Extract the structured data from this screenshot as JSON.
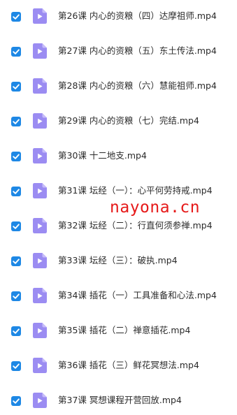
{
  "colors": {
    "checkbox": "#1e88e5",
    "file_icon": "#9b8cf2",
    "file_icon_fold": "#c7bdf9",
    "watermark": "#e61919"
  },
  "files": [
    {
      "name": "第26课 内心的资粮（四）达摩祖师.mp4",
      "checked": true,
      "icon": "video-file-icon"
    },
    {
      "name": "第27课 内心的资粮（五）东土传法.mp4",
      "checked": true,
      "icon": "video-file-icon"
    },
    {
      "name": "第28课 内心的资粮（六）慧能祖师.mp4",
      "checked": true,
      "icon": "video-file-icon"
    },
    {
      "name": "第29课 内心的资粮（七）完结.mp4",
      "checked": true,
      "icon": "video-file-icon"
    },
    {
      "name": "第30课 十二地支.mp4",
      "checked": true,
      "icon": "video-file-icon"
    },
    {
      "name": "第31课 坛经（一）：心平何劳持戒.mp4",
      "checked": true,
      "icon": "video-file-icon"
    },
    {
      "name": "第32课 坛经（二）：行直何须参禅.mp4",
      "checked": true,
      "icon": "video-file-icon"
    },
    {
      "name": "第33课 坛经（三）：破执.mp4",
      "checked": true,
      "icon": "video-file-icon"
    },
    {
      "name": "第34课 插花（一）工具准备和心法.mp4",
      "checked": true,
      "icon": "video-file-icon"
    },
    {
      "name": "第35课 插花（二）禅意插花.mp4",
      "checked": true,
      "icon": "video-file-icon"
    },
    {
      "name": "第36课 插花（三）鲜花冥想法.mp4",
      "checked": true,
      "icon": "video-file-icon"
    },
    {
      "name": "第37课 冥想课程开营回放.mp4",
      "checked": true,
      "icon": "video-file-icon"
    }
  ],
  "watermark": "nayona.cn"
}
